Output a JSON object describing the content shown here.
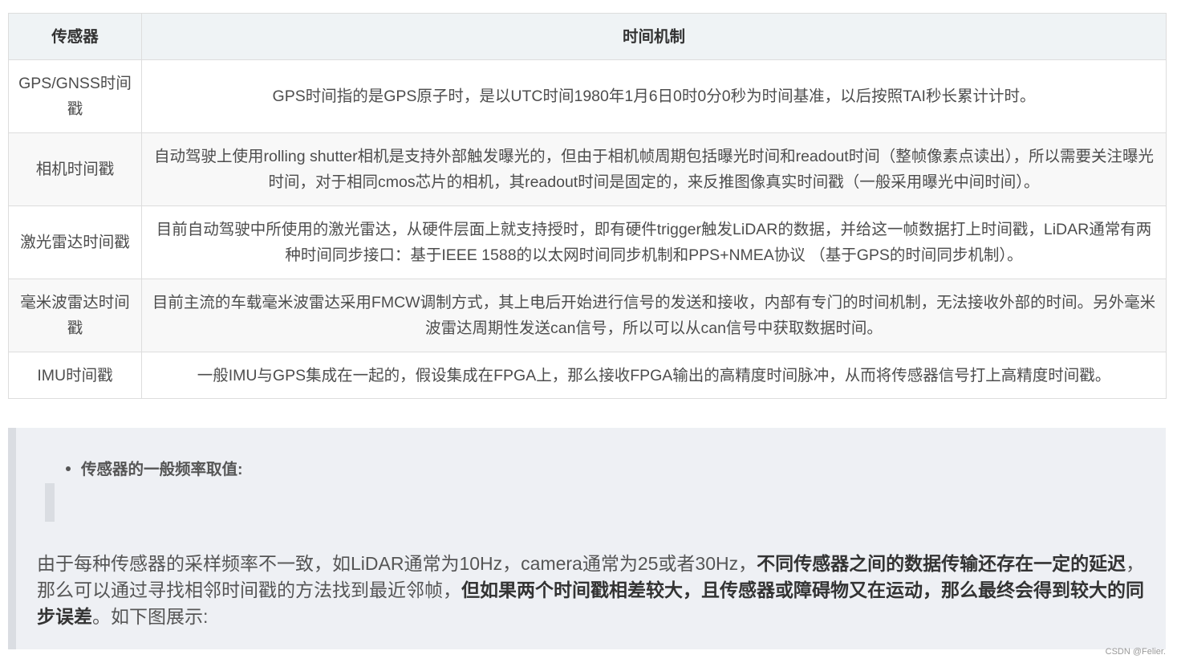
{
  "table": {
    "headers": [
      "传感器",
      "时间机制"
    ],
    "rows": [
      {
        "sensor": "GPS/GNSS时间戳",
        "mechanism": "GPS时间指的是GPS原子时，是以UTC时间1980年1月6日0时0分0秒为时间基准，以后按照TAI秒长累计计时。"
      },
      {
        "sensor": "相机时间戳",
        "mechanism": "自动驾驶上使用rolling shutter相机是支持外部触发曝光的，但由于相机帧周期包括曝光时间和readout时间（整帧像素点读出），所以需要关注曝光时间，对于相同cmos芯片的相机，其readout时间是固定的，来反推图像真实时间戳（一般采用曝光中间时间）。"
      },
      {
        "sensor": "激光雷达时间戳",
        "mechanism": "目前自动驾驶中所使用的激光雷达，从硬件层面上就支持授时，即有硬件trigger触发LiDAR的数据，并给这一帧数据打上时间戳，LiDAR通常有两种时间同步接口：基于IEEE 1588的以太网时间同步机制和PPS+NMEA协议 （基于GPS的时间同步机制）。"
      },
      {
        "sensor": "毫米波雷达时间戳",
        "mechanism": "目前主流的车载毫米波雷达采用FMCW调制方式，其上电后开始进行信号的发送和接收，内部有专门的时间机制，无法接收外部的时间。另外毫米波雷达周期性发送can信号，所以可以从can信号中获取数据时间。"
      },
      {
        "sensor": "IMU时间戳",
        "mechanism": "一般IMU与GPS集成在一起的，假设集成在FPGA上，那么接收FPGA输出的高精度时间脉冲，从而将传感器信号打上高精度时间戳。"
      }
    ]
  },
  "quote": {
    "bullet": "传感器的一般频率取值:",
    "paragraph": {
      "p1": "由于每种传感器的采样频率不一致，如LiDAR通常为10Hz，camera通常为25或者30Hz，",
      "b1": "不同传感器之间的数据传输还存在一定的延迟",
      "p2": "，那么可以通过寻找相邻时间戳的方法找到最近邻帧，",
      "b2": "但如果两个时间戳相差较大，且传感器或障碍物又在运动，那么最终会得到较大的同步误差",
      "p3": "。如下图展示:"
    }
  },
  "watermark": "CSDN @Felier."
}
